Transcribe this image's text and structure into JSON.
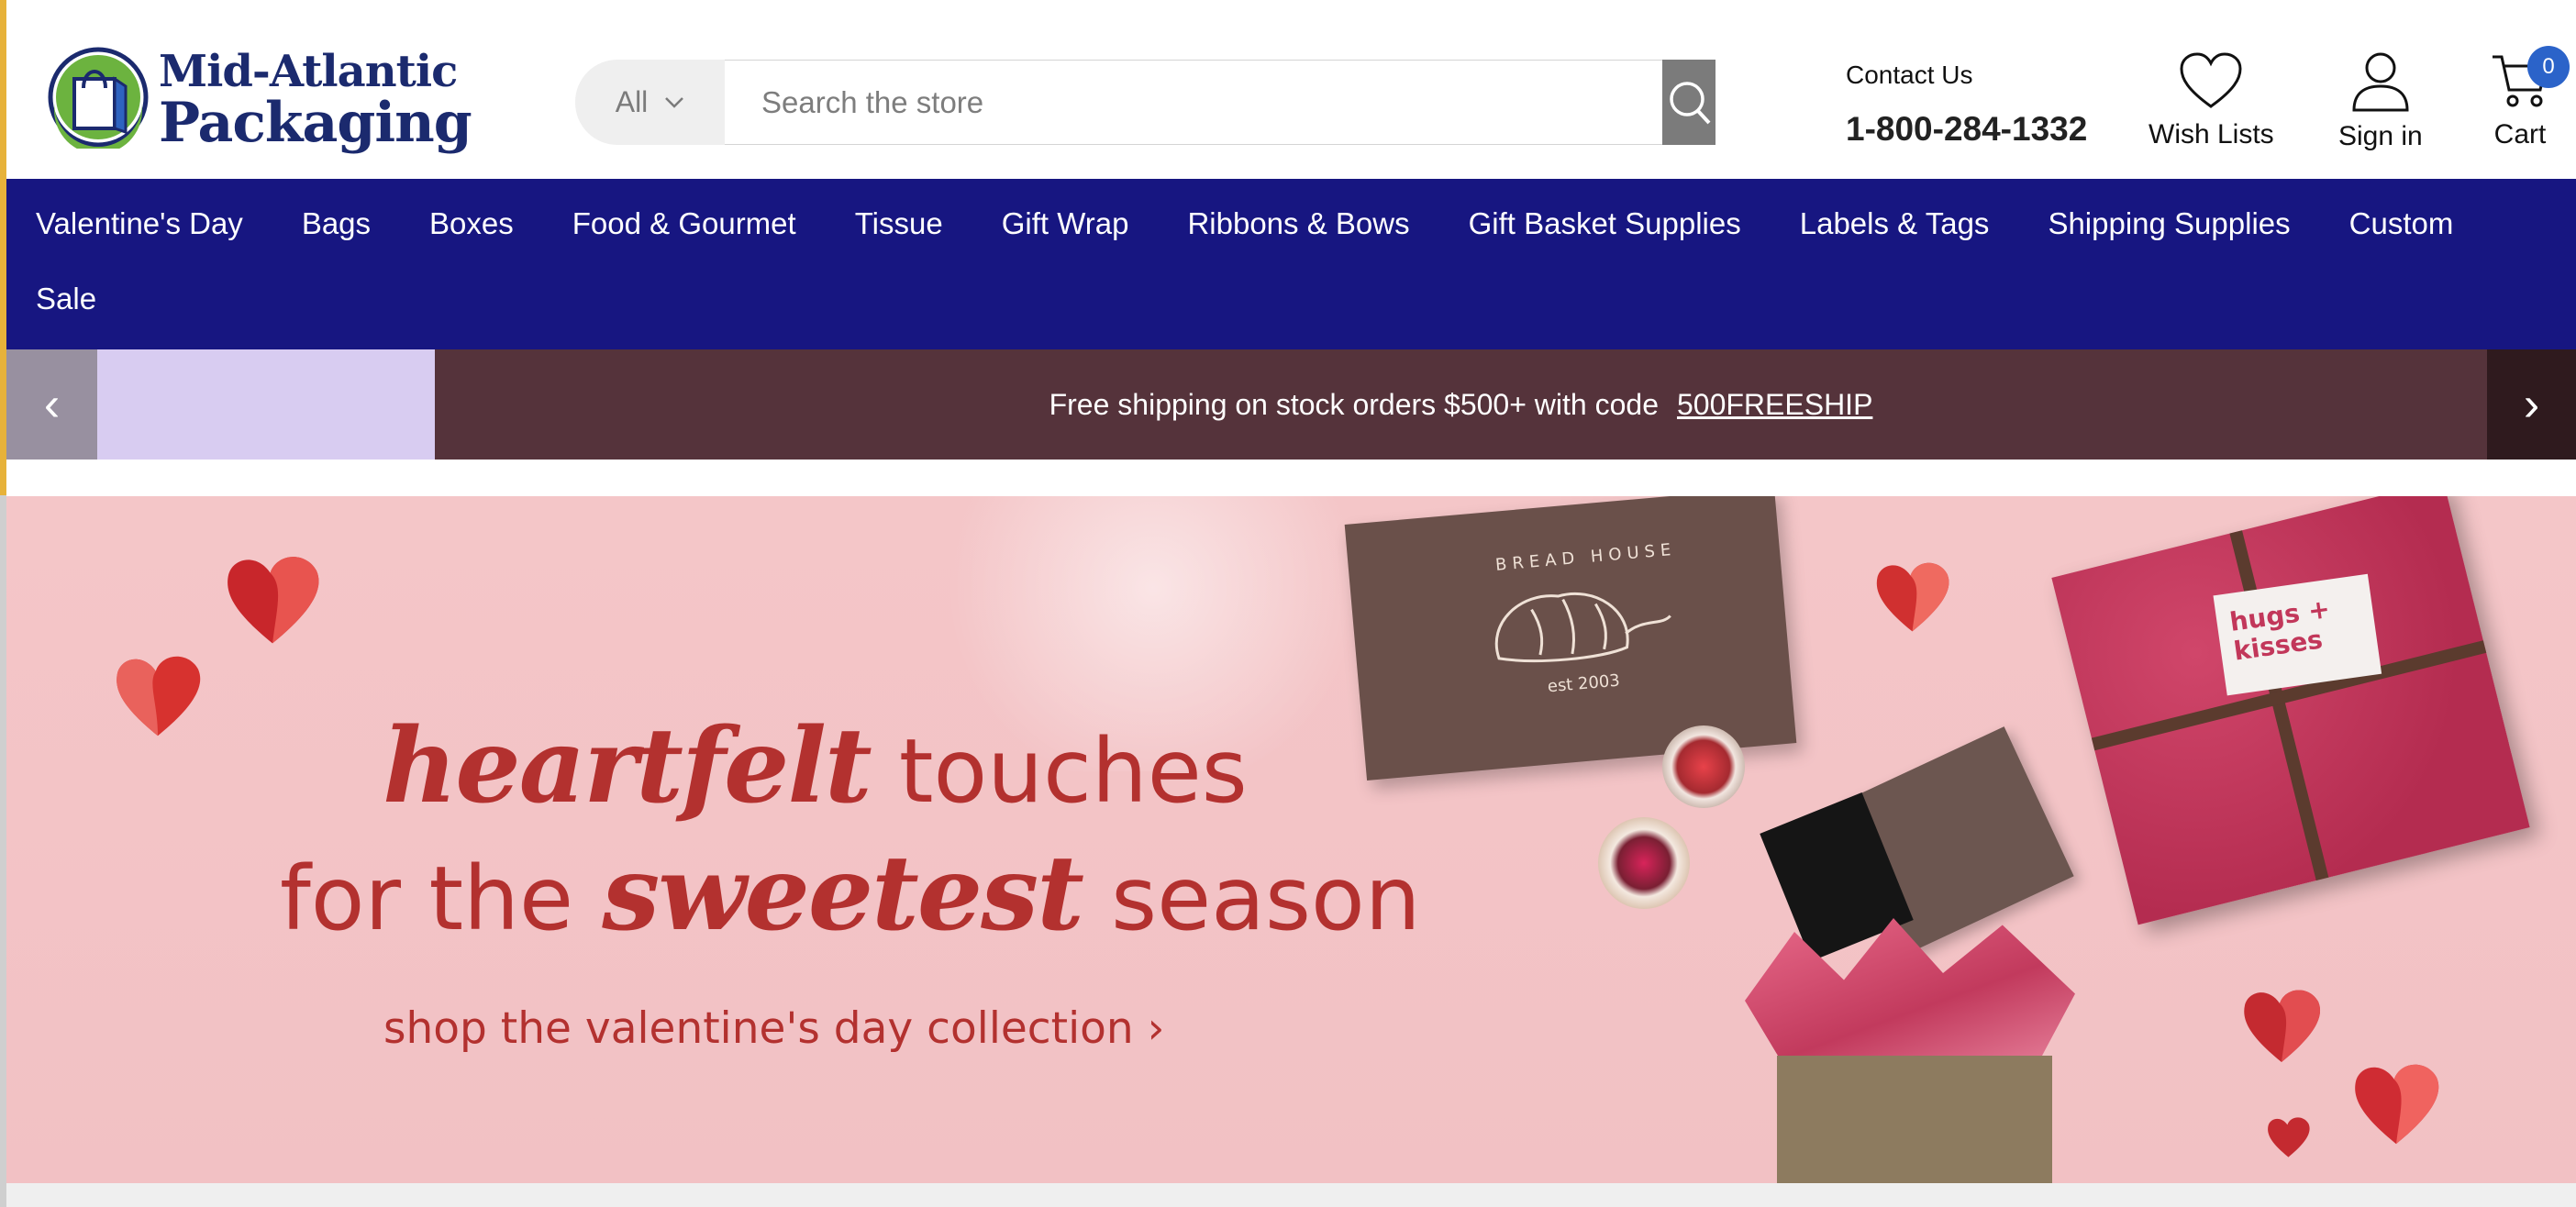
{
  "brand": {
    "name_line1": "Mid-Atlantic",
    "name_line2": "Packaging",
    "colors": {
      "navy": "#1b2a6e",
      "green": "#6cb33f"
    }
  },
  "search": {
    "scope_label": "All",
    "placeholder": "Search the store",
    "icon": "search-icon"
  },
  "contact": {
    "label": "Contact Us",
    "phone": "1-800-284-1332"
  },
  "header_actions": {
    "wishlist_label": "Wish Lists",
    "signin_label": "Sign in",
    "cart_label": "Cart",
    "cart_count": "0"
  },
  "nav": {
    "background": "#171681",
    "items": [
      "Valentine's Day",
      "Bags",
      "Boxes",
      "Food & Gourmet",
      "Tissue",
      "Gift Wrap",
      "Ribbons & Bows",
      "Gift Basket Supplies",
      "Labels & Tags",
      "Shipping Supplies",
      "Custom",
      "Sale"
    ]
  },
  "promo": {
    "prev_glyph": "‹",
    "next_glyph": "›",
    "text": "Free shipping on stock orders $500+ with code",
    "code": "500FREESHIP",
    "background": "#55333b"
  },
  "hero": {
    "line1_script": "heartfelt",
    "line1_plain": "touches",
    "line2_plain_a": "for the",
    "line2_script": "sweetest",
    "line2_plain_b": "season",
    "cta": "shop the valentine's day collection ›",
    "box_label_1": "BREAD HOUSE",
    "box_label_2": "est 2003",
    "tag_text_1": "hugs +",
    "tag_text_2": "kisses",
    "text_color": "#b3312f"
  }
}
